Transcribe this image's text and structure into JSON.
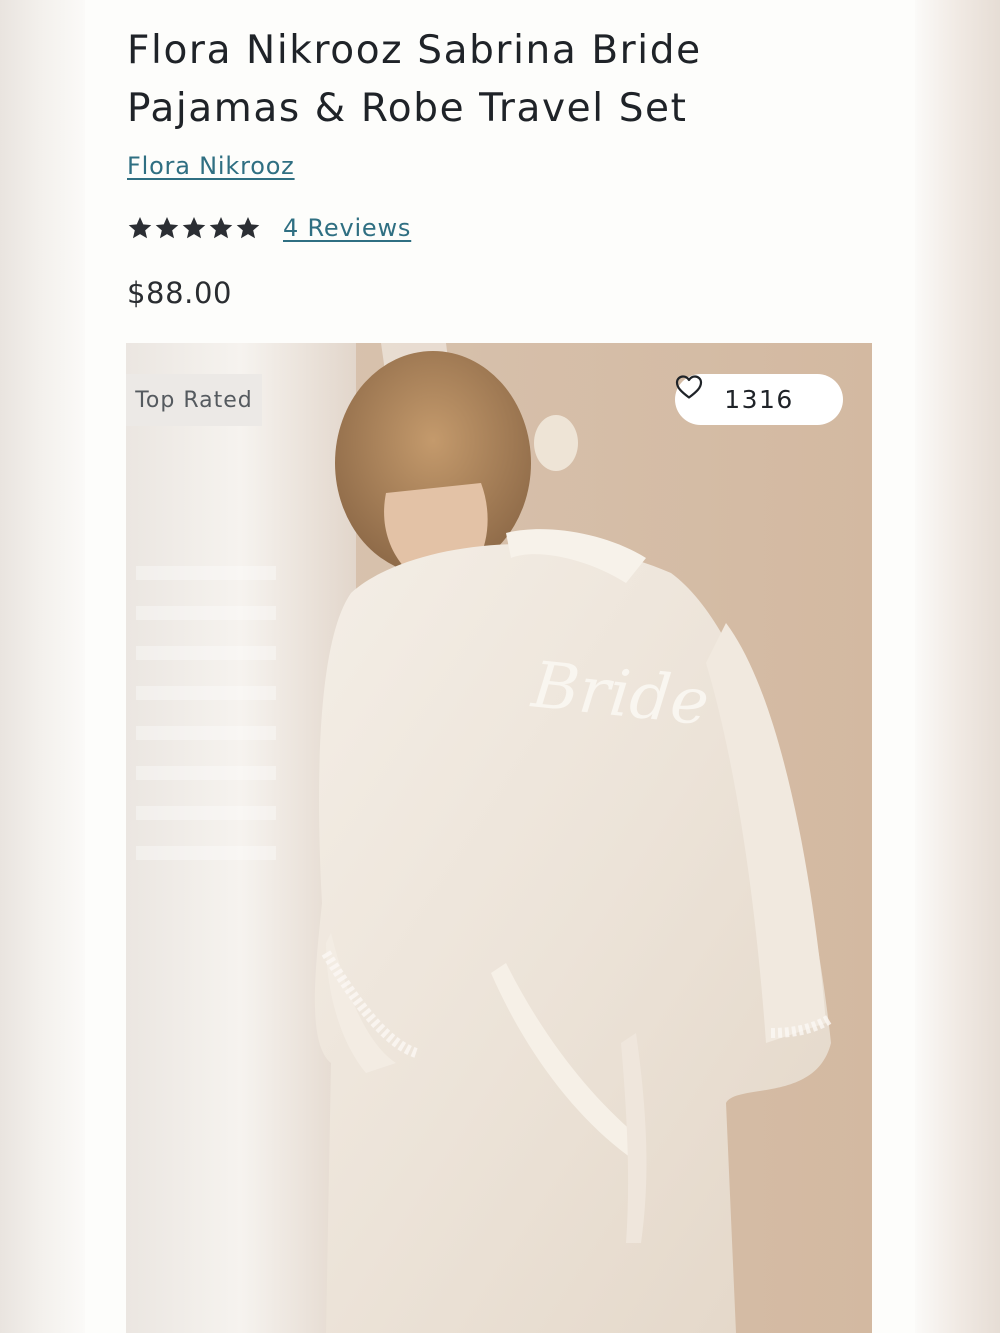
{
  "product": {
    "title": "Flora Nikrooz Sabrina Bride Pajamas & Robe Travel Set",
    "brand": "Flora Nikrooz",
    "rating": 5,
    "rating_max": 5,
    "reviews_label": "4 Reviews",
    "price": "$88.00"
  },
  "image": {
    "badge": "Top Rated",
    "like_count": "1316",
    "alt": "Woman wearing an ivory satin robe embroidered with Bride on the back"
  },
  "icons": {
    "star": "star-icon",
    "heart": "heart-outline-icon"
  },
  "colors": {
    "link": "#2f6f82",
    "text": "#1f2328",
    "star": "#2b2e33"
  }
}
